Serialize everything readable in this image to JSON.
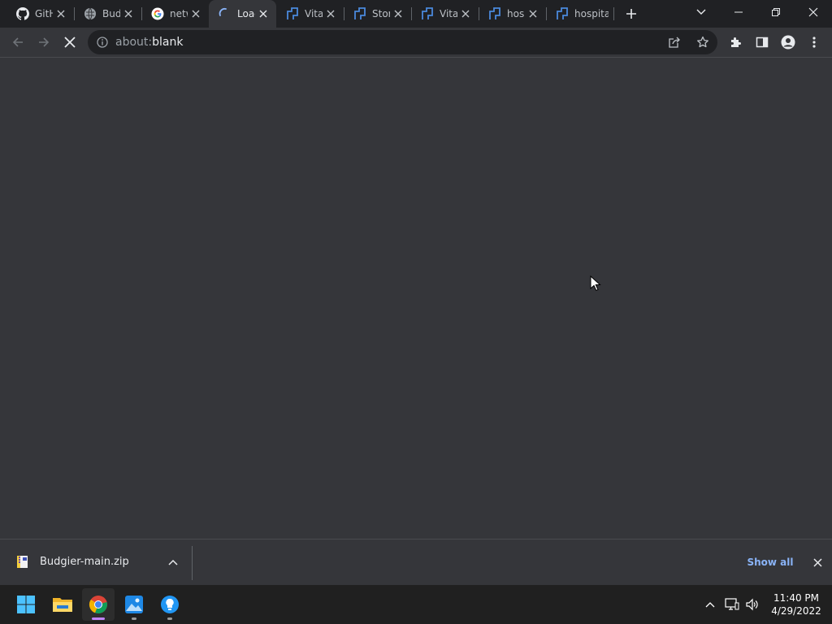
{
  "tabs": [
    {
      "title": "GitHub",
      "icon": "github-icon",
      "active": false
    },
    {
      "title": "Budgier",
      "icon": "web-globe-icon",
      "active": false
    },
    {
      "title": "network",
      "icon": "google-icon",
      "active": false
    },
    {
      "title": "Loading",
      "icon": "loading-spinner-icon",
      "active": true
    },
    {
      "title": "Vital",
      "icon": "site-logo-icon",
      "active": false
    },
    {
      "title": "Store",
      "icon": "site-logo-icon",
      "active": false
    },
    {
      "title": "Vital",
      "icon": "site-logo-icon",
      "active": false
    },
    {
      "title": "hospital",
      "icon": "site-logo-icon",
      "active": false
    },
    {
      "title": "hospital",
      "icon": "site-logo-icon",
      "active": false
    }
  ],
  "toolbar": {
    "url_scheme": "about:",
    "url_host": "blank"
  },
  "download_shelf": {
    "file_name": "Budgier-main.zip",
    "show_all_label": "Show all"
  },
  "taskbar": {
    "apps": [
      "start-menu",
      "file-explorer",
      "chrome",
      "photos",
      "tips"
    ],
    "time": "11:40 PM",
    "date": "4/29/2022"
  },
  "colors": {
    "accent_link": "#8ab4f8",
    "toolbar_bg": "#35363a",
    "frame_bg": "#202124",
    "taskbar_bg": "#202020"
  }
}
